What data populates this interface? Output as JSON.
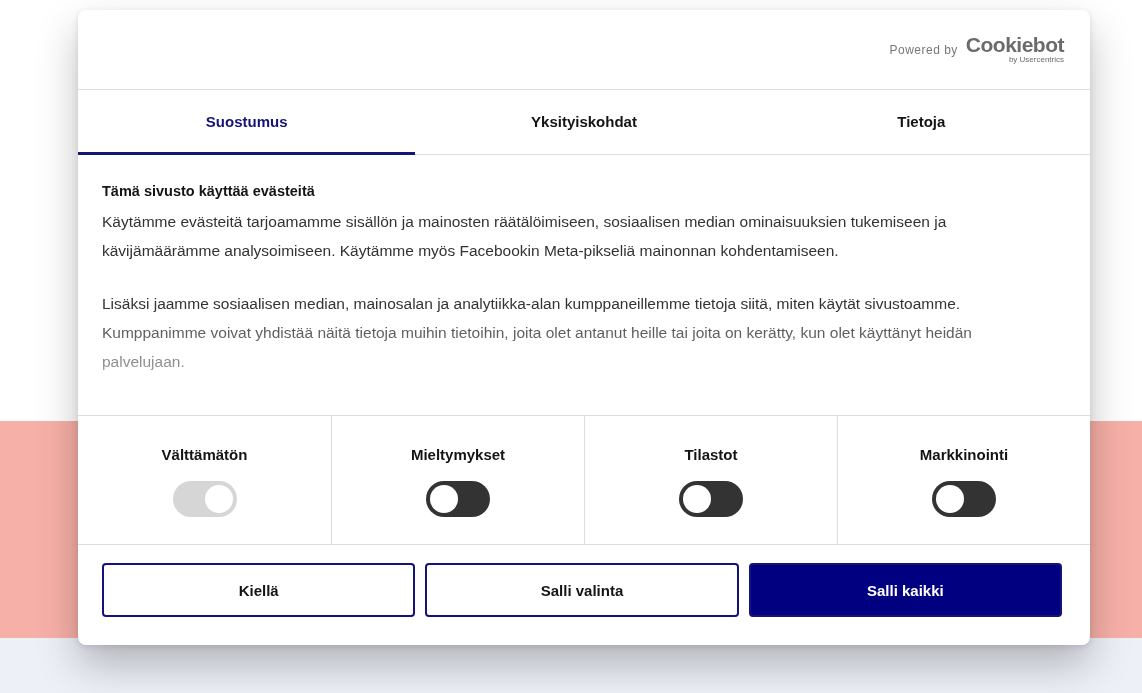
{
  "branding": {
    "powered_by": "Powered by",
    "logo": "Cookiebot",
    "logo_sub": "by Usercentrics"
  },
  "tabs": [
    {
      "label": "Suostumus",
      "selected": true
    },
    {
      "label": "Yksityiskohdat",
      "selected": false
    },
    {
      "label": "Tietoja",
      "selected": false
    }
  ],
  "content": {
    "title": "Tämä sivusto käyttää evästeitä",
    "paragraphs": [
      "Käytämme evästeitä tarjoamamme sisällön ja mainosten räätälöimiseen, sosiaalisen median ominaisuuksien tukemiseen ja kävijämäärämme analysoimiseen. Käytämme myös Facebookin Meta-pikseliä mainonnan kohdentamiseen.",
      "Lisäksi jaamme sosiaalisen median, mainosalan ja analytiikka-alan kumppaneillemme tietoja siitä, miten käytät sivustoamme. Kumppanimme voivat yhdistää näitä tietoja muihin tietoihin, joita olet antanut heille tai joita on kerätty, kun olet käyttänyt heidän palvelujaan."
    ]
  },
  "categories": [
    {
      "label": "Välttämätön",
      "on": true,
      "disabled": true
    },
    {
      "label": "Mieltymykset",
      "on": false,
      "disabled": false
    },
    {
      "label": "Tilastot",
      "on": false,
      "disabled": false
    },
    {
      "label": "Markkinointi",
      "on": false,
      "disabled": false
    }
  ],
  "buttons": [
    {
      "label": "Kiellä",
      "kind": "outline"
    },
    {
      "label": "Salli valinta",
      "kind": "outline"
    },
    {
      "label": "Salli kaikki",
      "kind": "primary"
    }
  ]
}
